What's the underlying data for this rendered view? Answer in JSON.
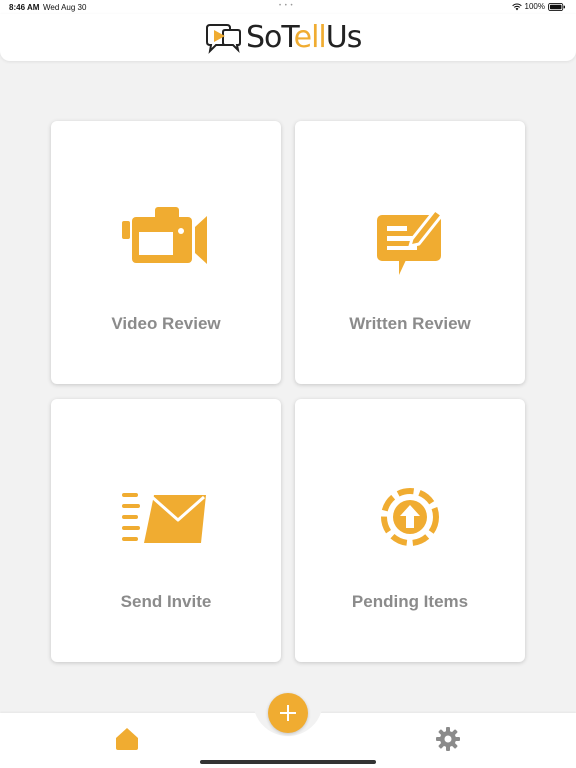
{
  "status_bar": {
    "time": "8:46 AM",
    "date": "Wed Aug 30",
    "battery": "100%"
  },
  "app": {
    "logo_prefix": "SoT",
    "logo_accent": "ell",
    "logo_suffix": "Us"
  },
  "colors": {
    "accent": "#f0ac31",
    "label_gray": "#8b8b8b",
    "background": "#f2f2f2"
  },
  "tiles": [
    {
      "label": "Video Review",
      "icon": "video-camera-icon"
    },
    {
      "label": "Written Review",
      "icon": "written-review-icon"
    },
    {
      "label": "Send Invite",
      "icon": "envelope-icon"
    },
    {
      "label": "Pending Items",
      "icon": "upload-pending-icon"
    }
  ],
  "tab_bar": {
    "items": [
      {
        "name": "home",
        "icon": "home-icon",
        "active": true
      },
      {
        "name": "add",
        "icon": "plus-icon"
      },
      {
        "name": "settings",
        "icon": "gear-icon"
      }
    ]
  }
}
